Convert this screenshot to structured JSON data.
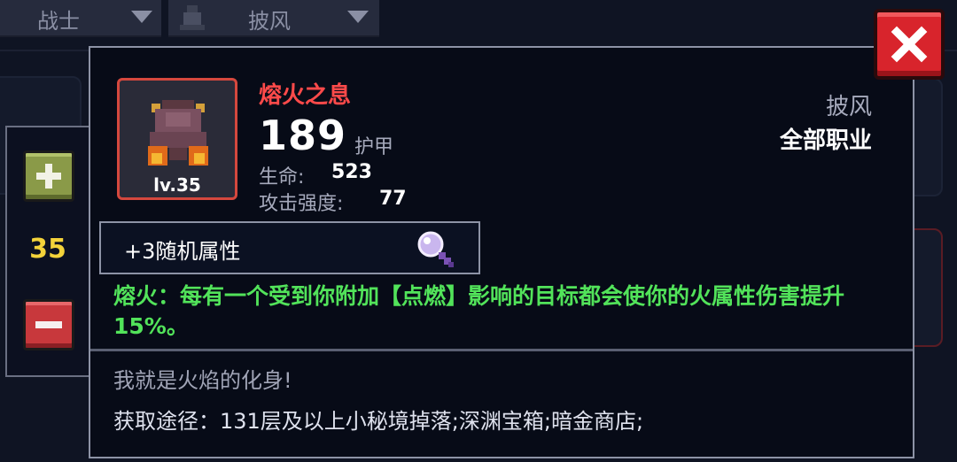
{
  "filters": {
    "class_label": "战士",
    "slot_label": "披风"
  },
  "stepper": {
    "level": "35"
  },
  "item": {
    "name": "熔火之息",
    "level_label": "lv.35",
    "armor_value": "189",
    "armor_label": "护甲",
    "stats": {
      "hp_label": "生命:",
      "hp_value": "523",
      "attack_label": "攻击强度:",
      "attack_value": "77"
    },
    "slot": "披风",
    "class_restriction": "全部职业",
    "random_attributes": "+3随机属性",
    "effect": "熔火：每有一个受到你附加【点燃】影响的目标都会使你的火属性伤害提升15%。",
    "flavor": "我就是火焰的化身!",
    "source": "获取途径：131层及以上小秘境掉落;深渊宝箱;暗金商店;"
  },
  "colors": {
    "item_name": "#ff4a4a",
    "effect_text": "#52e35a",
    "level_value": "#f3d23a",
    "close_button": "#d8242c"
  },
  "icons": {
    "close": "close-x-icon",
    "plus": "plus-icon",
    "minus": "minus-icon",
    "search": "magnifier-icon",
    "slot": "cloak-slot-icon"
  }
}
